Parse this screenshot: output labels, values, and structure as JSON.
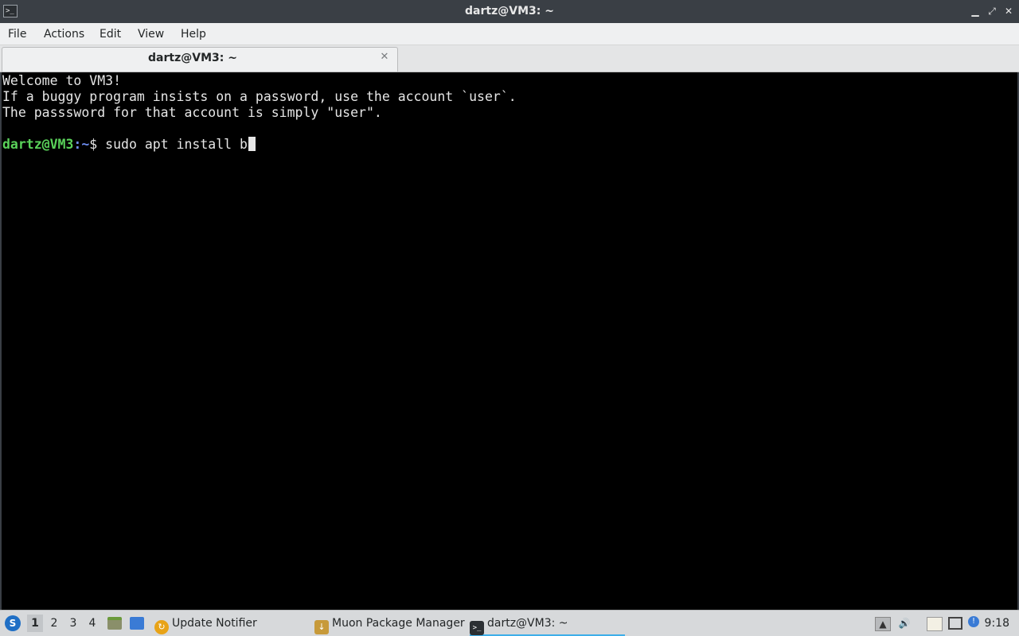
{
  "window": {
    "title": "dartz@VM3: ~",
    "minimize_glyph": "▁",
    "restore_glyph": "⤢",
    "close_glyph": "✕",
    "app_icon_glyph": ">_"
  },
  "menubar": {
    "file": "File",
    "actions": "Actions",
    "edit": "Edit",
    "view": "View",
    "help": "Help"
  },
  "tabs": [
    {
      "label": "dartz@VM3: ~",
      "close_glyph": "✕"
    }
  ],
  "terminal": {
    "lines": [
      "Welcome to VM3!",
      "If a buggy program insists on a password, use the account `user`.",
      "The passsword for that account is simply \"user\"."
    ],
    "prompt_user": "dartz@VM3",
    "prompt_sep": ":",
    "prompt_path": "~",
    "prompt_dollar": "$ ",
    "command": "sudo apt install b"
  },
  "taskbar": {
    "start_glyph": "S",
    "workspaces": [
      "1",
      "2",
      "3",
      "4"
    ],
    "active_workspace": "1",
    "tasks": [
      {
        "label": "Update Notifier",
        "icon": "update-notifier-icon",
        "color": "#e8a317"
      },
      {
        "label": "Muon Package Manager",
        "icon": "muon-package-icon",
        "color": "#c79a3a"
      },
      {
        "label": "dartz@VM3: ~",
        "icon": "terminal-icon",
        "color": "#2b2f33"
      }
    ],
    "clock": "9:18"
  },
  "colors": {
    "titlebar": "#3a3f45",
    "prompt_user": "#5ad25a",
    "prompt_path": "#6d8df0",
    "accent": "#3daee9"
  }
}
